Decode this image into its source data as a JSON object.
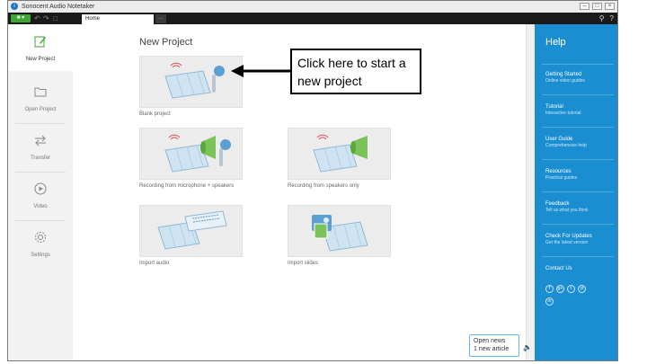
{
  "titlebar": {
    "app_title": "Sonocent Audio Notetaker",
    "app_glyph": "i"
  },
  "tabbar": {
    "home_tab": "Home",
    "new_tab": "...",
    "menu_label": "■ ▾"
  },
  "sidebar": {
    "items": [
      {
        "label": "New Project",
        "icon": "edit-icon"
      },
      {
        "label": "Open Project",
        "icon": "folder-icon"
      },
      {
        "label": "Transfer",
        "icon": "transfer-icon"
      },
      {
        "label": "Video",
        "icon": "play-icon"
      },
      {
        "label": "Settings",
        "icon": "gear-icon"
      }
    ]
  },
  "main": {
    "title": "New Project",
    "cards": [
      {
        "label": "Blank project"
      },
      {
        "label": "Recording from microphone + speakers"
      },
      {
        "label": "Recording from speakers only"
      },
      {
        "label": "Import audio"
      },
      {
        "label": "Import slides"
      }
    ]
  },
  "help": {
    "title": "Help",
    "items": [
      {
        "title": "Getting Started",
        "subtitle": "Online video guides"
      },
      {
        "title": "Tutorial",
        "subtitle": "Interactive tutorial"
      },
      {
        "title": "User Guide",
        "subtitle": "Comprehensive help"
      },
      {
        "title": "Resources",
        "subtitle": "Practical guides"
      },
      {
        "title": "Feedback",
        "subtitle": "Tell us what you think"
      },
      {
        "title": "Check For Updates",
        "subtitle": "Get the latest version"
      },
      {
        "title": "Contact Us",
        "subtitle": ""
      }
    ],
    "social": [
      "f",
      "g+",
      "t",
      "yt",
      "in"
    ]
  },
  "news": {
    "line1": "Open news",
    "line2": "1 new article"
  },
  "callout": {
    "text": "Click here to start a new project"
  },
  "colors": {
    "accent": "#1a8ed1",
    "menu_green": "#3fa535",
    "tab_dark": "#1a1a1a",
    "sidebar_bg": "#f2f2f2"
  }
}
